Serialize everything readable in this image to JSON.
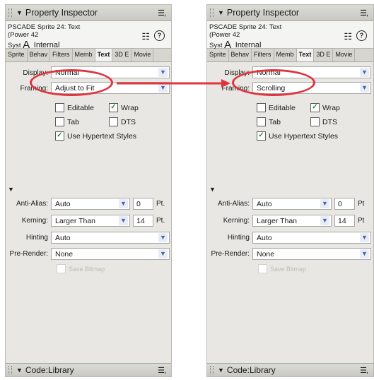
{
  "panels": [
    {
      "title": "Property Inspector",
      "info_line1": "PSCADE Sprite 24: Text",
      "info_line2": "(Power  42",
      "info_line3_prefix": "Syst",
      "info_glyph": "A",
      "info_type": "Internal",
      "tabs": [
        "Sprite",
        "Behav",
        "Filters",
        "Memb",
        "Text",
        "3D E",
        "Movie"
      ],
      "display_label": "Display:",
      "display_value": "Normal",
      "framing_label": "Framing:",
      "framing_value": "Adjust to Fit",
      "checkboxes": [
        {
          "label": "Editable",
          "checked": false
        },
        {
          "label": "Wrap",
          "checked": true
        },
        {
          "label": "Tab",
          "checked": false
        },
        {
          "label": "DTS",
          "checked": false
        },
        {
          "label": "Use Hypertext Styles",
          "checked": true
        }
      ],
      "antialias_label": "Anti-Alias:",
      "antialias_value": "Auto",
      "antialias_pt": "0",
      "kerning_label": "Kerning:",
      "kerning_value": "Larger Than",
      "kerning_pt": "14",
      "pt_unit": "Pt.",
      "hinting_label": "Hinting",
      "hinting_value": "Auto",
      "prerender_label": "Pre-Render:",
      "prerender_value": "None",
      "save_bitmap_label": "Save Bitmap",
      "bottom_title": "Code:Library"
    },
    {
      "title": "Property Inspector",
      "info_line1": "PSCADE Sprite 24: Text",
      "info_line2": "(Power  42",
      "info_line3_prefix": "Syst",
      "info_glyph": "A",
      "info_type": "Internal",
      "tabs": [
        "Sprite",
        "Behav",
        "Filters",
        "Memb",
        "Text",
        "3D E",
        "Movie"
      ],
      "display_label": "Display:",
      "display_value": "Normal",
      "framing_label": "Framing:",
      "framing_value": "Scrolling",
      "checkboxes": [
        {
          "label": "Editable",
          "checked": false
        },
        {
          "label": "Wrap",
          "checked": true
        },
        {
          "label": "Tab",
          "checked": false
        },
        {
          "label": "DTS",
          "checked": false
        },
        {
          "label": "Use Hypertext Styles",
          "checked": true
        }
      ],
      "antialias_label": "Anti-Alias:",
      "antialias_value": "Auto",
      "antialias_pt": "0",
      "kerning_label": "Kerning:",
      "kerning_value": "Larger Than",
      "kerning_pt": "14",
      "pt_unit": "Pt",
      "hinting_label": "Hinting",
      "hinting_value": "Auto",
      "prerender_label": "Pre-Render:",
      "prerender_value": "None",
      "save_bitmap_label": "Save Bitmap",
      "bottom_title": "Code:Library"
    }
  ],
  "colors": {
    "highlight": "#e0343f",
    "check": "#2c8a2c",
    "panel_bg": "#e8e7e3"
  },
  "icons": [
    "menu-icon",
    "list-icon",
    "help-icon",
    "collapse-triangle-icon",
    "dropdown-arrow-icon",
    "checkmark-icon"
  ]
}
